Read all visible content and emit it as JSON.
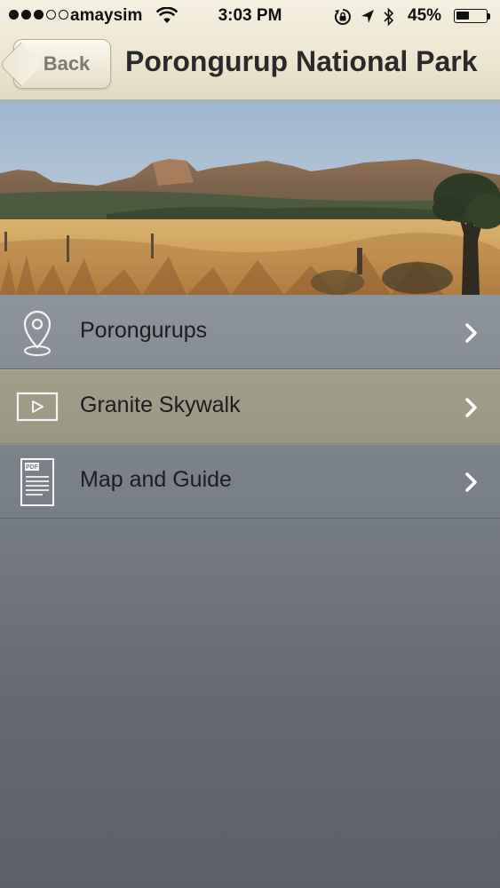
{
  "status_bar": {
    "carrier": "amaysim",
    "time": "3:03 PM",
    "battery_percent": "45%",
    "battery_level": 0.45,
    "signal_bars_filled": 3,
    "signal_bars_total": 5,
    "icons": [
      "wifi-icon",
      "rotation-lock-icon",
      "location-arrow-icon",
      "bluetooth-icon",
      "battery-icon"
    ]
  },
  "nav": {
    "back_label": "Back",
    "title": "Porongurup National Park"
  },
  "hero": {
    "description_icon": "landscape-photo"
  },
  "menu": {
    "items": [
      {
        "label": "Porongurups",
        "icon": "map-pin-icon"
      },
      {
        "label": "Granite Skywalk",
        "icon": "video-play-icon"
      },
      {
        "label": "Map and Guide",
        "icon": "pdf-document-icon"
      }
    ],
    "pdf_badge": "PDF"
  },
  "colors": {
    "header_bg": "#ece6d1",
    "row_default": "#8a9098",
    "row_selected": "#9e9b86",
    "background": "#6e737b"
  }
}
